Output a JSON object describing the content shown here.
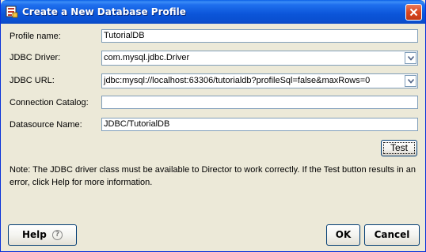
{
  "window": {
    "title": "Create a New Database Profile"
  },
  "form": {
    "profile_name": {
      "label": "Profile name:",
      "value": "TutorialDB"
    },
    "jdbc_driver": {
      "label": "JDBC Driver:",
      "value": "com.mysql.jdbc.Driver"
    },
    "jdbc_url": {
      "label": "JDBC URL:",
      "value": "jdbc:mysql://localhost:63306/tutorialdb?profileSql=false&maxRows=0"
    },
    "connection_catalog": {
      "label": "Connection Catalog:",
      "value": ""
    },
    "datasource_name": {
      "label": "Datasource Name:",
      "value": "JDBC/TutorialDB"
    }
  },
  "test_button": {
    "label": "Test"
  },
  "note": "Note: The JDBC driver class must be available to Director to work correctly. If the Test button results in an error, click Help for more information.",
  "footer": {
    "help_label": "Help",
    "help_icon_glyph": "?",
    "ok_label": "OK",
    "cancel_label": "Cancel"
  },
  "icons": {
    "title": "database-icon",
    "close": "close-icon",
    "dropdown": "chevron-down-icon",
    "help": "help-circle-icon"
  }
}
